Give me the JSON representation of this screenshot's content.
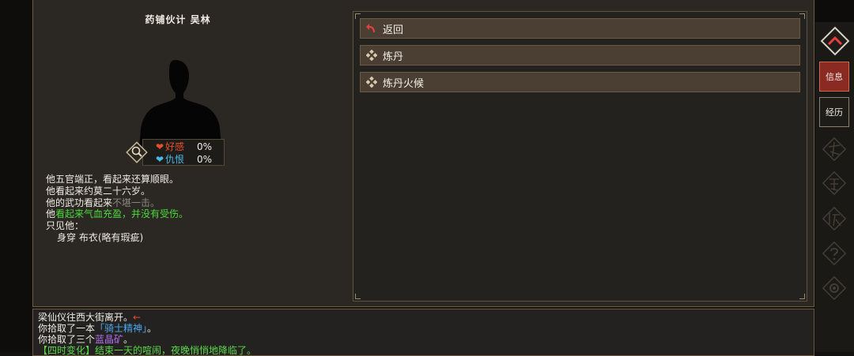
{
  "npc": {
    "title": "药铺伙计 吴林",
    "favor": {
      "label": "好感",
      "value": "0%"
    },
    "hatred": {
      "label": "仇恨",
      "value": "0%"
    }
  },
  "description": {
    "line1": "他五官端正，看起来还算顺眼。",
    "line2": "他看起来约莫二十六岁。",
    "line3_prefix": "他的武功看起来",
    "line3_status": "不堪一击。",
    "line4_prefix": "他",
    "line4_status": "看起来气血充盈，并没有受伤。",
    "line5": "只见他：",
    "line6_label": "身穿",
    "line6_item": "布衣(略有瑕疵)"
  },
  "menu": {
    "items": [
      {
        "label": "返回",
        "icon": "return-arrow-icon"
      },
      {
        "label": "炼丹",
        "icon": "diamond-icon"
      },
      {
        "label": "炼丹火候",
        "icon": "diamond-icon"
      }
    ]
  },
  "sidebar": {
    "info_label": "信息",
    "history_label": "经历"
  },
  "log": {
    "line1": "梁仙仪往西大街离开。",
    "line1_arrow": "←",
    "line2_prefix": "你拾取了一本",
    "line2_item": "「骑士精神」",
    "line2_suffix": "。",
    "line3_prefix": "你拾取了三个",
    "line3_item": "蓝晶矿",
    "line3_suffix": "。",
    "line4": "【四时变化】结束一天的喧闹，夜晚悄悄地降临了。"
  },
  "colors": {
    "favor_heart": "#e8502a",
    "hatred_heart": "#4ab8e8",
    "info_button_bg": "#8a2a22",
    "status_green": "#4cd93c"
  }
}
